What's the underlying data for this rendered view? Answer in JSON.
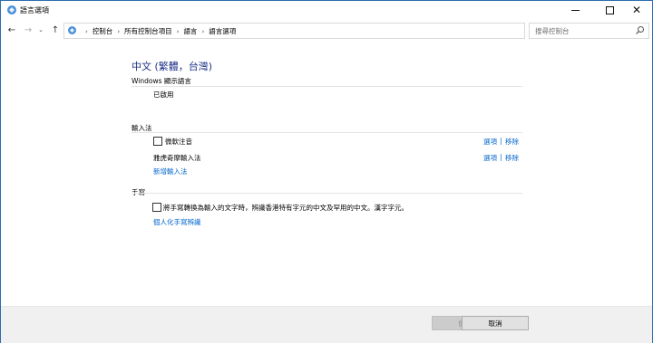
{
  "window": {
    "title": "語言選項",
    "controls": {
      "minimize": "—",
      "maximize": "☐",
      "close": "✕"
    }
  },
  "navigation": {
    "back": "←",
    "forward": "→",
    "recent": "⌄",
    "up": "↑",
    "breadcrumbs": [
      "控制台",
      "所有控制台項目",
      "語言",
      "語言選項"
    ],
    "dropdown": "⌄",
    "refresh": "↻",
    "search_placeholder": "搜尋控制台"
  },
  "page": {
    "title": "中文 (繁體，台灣)",
    "display_language": {
      "label": "Windows 顯示語言",
      "status": "已啟用"
    },
    "input_methods": {
      "label": "輸入法",
      "items": [
        {
          "name": "微軟注音",
          "options": "選項",
          "remove": "移除"
        },
        {
          "name": "雅虎奇摩輸入法",
          "options": "選項",
          "remove": "移除"
        }
      ],
      "add_link": "新增輸入法"
    },
    "handwriting": {
      "label": "手寫",
      "checkbox_label": "將手寫轉換為輸入的文字時，辨識香港特有字元的中文及罕用的中文。漢字字元。",
      "checked": false,
      "personalize_link": "個人化手寫辨識"
    }
  },
  "footer": {
    "save_label": "儲存",
    "cancel_label": "取消"
  },
  "colors": {
    "title": "#1e3287",
    "link": "#0066cc",
    "border": "#2b6cb0"
  }
}
